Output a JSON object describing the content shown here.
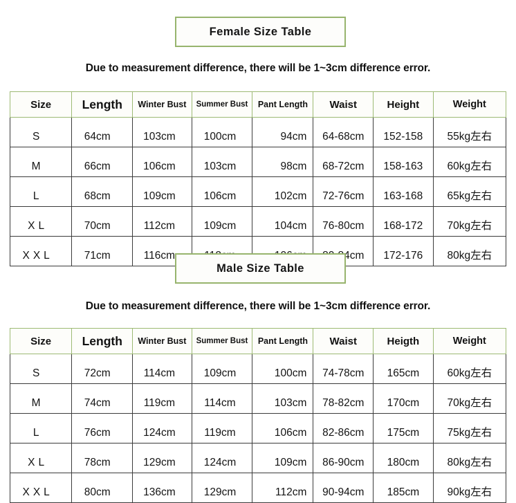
{
  "colors": {
    "banner_border": "#97b46d",
    "header_border": "#9dba74",
    "cell_border": "#3b3b3b",
    "text": "#121212",
    "background": "#ffffff"
  },
  "female": {
    "title": "Female Size Table",
    "note": "Due to measurement difference, there will be 1~3cm difference error.",
    "columns": [
      "Size",
      "Length",
      "Winter Bust",
      "Summer Bust",
      "Pant Length",
      "Waist",
      "Height",
      "Weight"
    ],
    "rows": [
      [
        "S",
        "64cm",
        "103cm",
        "100cm",
        "94cm",
        "64-68cm",
        "152-158",
        "55kg左右"
      ],
      [
        "M",
        "66cm",
        "106cm",
        "103cm",
        "98cm",
        "68-72cm",
        "158-163",
        "60kg左右"
      ],
      [
        "L",
        "68cm",
        "109cm",
        "106cm",
        "102cm",
        "72-76cm",
        "163-168",
        "65kg左右"
      ],
      [
        "XL",
        "70cm",
        "112cm",
        "109cm",
        "104cm",
        "76-80cm",
        "168-172",
        "70kg左右"
      ],
      [
        "XXL",
        "71cm",
        "116cm",
        "112cm",
        "106cm",
        "80-84cm",
        "172-176",
        "80kg左右"
      ]
    ]
  },
  "male": {
    "title": "Male Size Table",
    "note": "Due to measurement difference, there will be 1~3cm difference error.",
    "columns": [
      "Size",
      "Length",
      "Winter Bust",
      "Summer Bust",
      "Pant Length",
      "Waist",
      "Heigth",
      "Weight"
    ],
    "rows": [
      [
        "S",
        "72cm",
        "114cm",
        "109cm",
        "100cm",
        "74-78cm",
        "165cm",
        "60kg左右"
      ],
      [
        "M",
        "74cm",
        "119cm",
        "114cm",
        "103cm",
        "78-82cm",
        "170cm",
        "70kg左右"
      ],
      [
        "L",
        "76cm",
        "124cm",
        "119cm",
        "106cm",
        "82-86cm",
        "175cm",
        "75kg左右"
      ],
      [
        "XL",
        "78cm",
        "129cm",
        "124cm",
        "109cm",
        "86-90cm",
        "180cm",
        "80kg左右"
      ],
      [
        "XXL",
        "80cm",
        "136cm",
        "129cm",
        "112cm",
        "90-94cm",
        "185cm",
        "90kg左右"
      ]
    ]
  }
}
